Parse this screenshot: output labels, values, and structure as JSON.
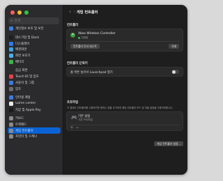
{
  "sidebar": {
    "search_placeholder": "검색",
    "items": [
      {
        "label": "개인정보 보호 및 보안",
        "icon": "hand-icon",
        "color": "#3a7be0"
      },
      {
        "label": "데스크탑 및 Dock",
        "icon": "dock-icon",
        "color": "#1e1e1e"
      },
      {
        "label": "디스플레이",
        "icon": "sun-icon",
        "color": "#2f7bea"
      },
      {
        "label": "배경화면",
        "icon": "wallpaper-icon",
        "color": "#39a3e6"
      },
      {
        "label": "화면 보호기",
        "icon": "screensaver-icon",
        "color": "#4ab0e8"
      },
      {
        "label": "배터리",
        "icon": "battery-icon",
        "color": "#39b54a"
      },
      {
        "label": "잠금 화면",
        "icon": "lock-icon",
        "color": "#2b2b2b"
      },
      {
        "label": "Touch ID 및 암호",
        "icon": "fingerprint-icon",
        "color": "#e4434a"
      },
      {
        "label": "사용자 및 그룹",
        "icon": "users-icon",
        "color": "#3a7be0"
      },
      {
        "label": "암호",
        "icon": "key-icon",
        "color": "#6d6d6d"
      },
      {
        "label": "인터넷 계정",
        "icon": "at-icon",
        "color": "#3a7be0"
      },
      {
        "label": "Game Center",
        "icon": "game-center-icon",
        "color": "#e9e9e9"
      },
      {
        "label": "지갑 및 Apple Pay",
        "icon": "wallet-icon",
        "color": "#1b1b1b"
      },
      {
        "label": "키보드",
        "icon": "keyboard-icon",
        "color": "#8a8a8a"
      },
      {
        "label": "트랙패드",
        "icon": "trackpad-icon",
        "color": "#8a8a8a"
      },
      {
        "label": "게임 컨트롤러",
        "icon": "game-controller-icon",
        "color": "#8a8a8a"
      },
      {
        "label": "프린터 및 스캐너",
        "icon": "printer-icon",
        "color": "#8a8a8a"
      }
    ],
    "selected_index": 15
  },
  "toolbar": {
    "back_glyph": "‹",
    "forward_glyph": "›",
    "title": "게임 컨트롤러"
  },
  "controllers": {
    "section_title": "컨트롤러",
    "device_name": "Xbox Wireless Controller",
    "device_status": "연결됨",
    "identify_button": "컨트롤러 인식 테스트",
    "remove_button": "삭제"
  },
  "shortcuts": {
    "section_title": "컨트롤러 단축키",
    "launchpad_label": "홈 버튼 눌러서 Launchpad 열기",
    "launchpad_enabled": false
  },
  "profiles": {
    "section_title": "프로파일",
    "description": "각 앱에서 컨트롤러를 사용하려면 원하는 앱을 추가하여 해당 컨트롤러 모드 및 개별 설정을 사용자화합니다.",
    "default_name": "기본 설정",
    "default_sub": "기본 프로파일",
    "add_glyph": "+",
    "remove_glyph": "−"
  },
  "footer": {
    "settings_button": "게임 컨트롤러 설정..."
  },
  "colors": {
    "accent": "#0a63d6",
    "window_bg": "#1e1e1e",
    "sidebar_bg": "#2b2a2c",
    "status_green": "#33c24d"
  }
}
